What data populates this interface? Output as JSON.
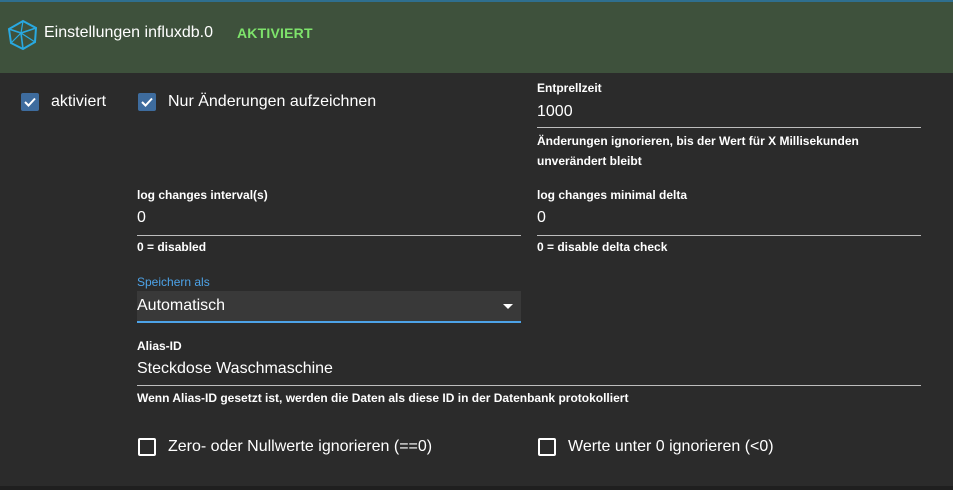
{
  "header": {
    "title": "Einstellungen influxdb.0",
    "status": "AKTIVIERT",
    "icon": "influxdb-logo-icon",
    "background_color": "#3e513c",
    "status_color": "#7ee36b"
  },
  "checkboxes": {
    "enabled": {
      "label": "aktiviert",
      "checked": true
    },
    "changes_only": {
      "label": "Nur Änderungen aufzeichnen",
      "checked": true
    },
    "ignore_zero": {
      "label": "Zero- oder Nullwerte ignorieren (==0)",
      "checked": false
    },
    "ignore_below_zero": {
      "label": "Werte unter 0 ignorieren (<0)",
      "checked": false
    }
  },
  "fields": {
    "debounce": {
      "label": "Entprellzeit",
      "value": "1000",
      "helper_line1": "Änderungen ignorieren, bis der Wert für X Millisekunden",
      "helper_line2": "unverändert bleibt"
    },
    "log_changes_interval": {
      "label": "log changes interval(s)",
      "value": "0",
      "helper": "0 = disabled"
    },
    "log_changes_min_delta": {
      "label": "log changes minimal delta",
      "value": "0",
      "helper": "0 = disable delta check"
    },
    "store_as": {
      "label": "Speichern als",
      "value": "Automatisch"
    },
    "alias_id": {
      "label": "Alias-ID",
      "value": "Steckdose Waschmaschine",
      "helper": "Wenn Alias-ID gesetzt ist, werden die Daten als diese ID in der Datenbank protokolliert"
    }
  },
  "colors": {
    "accent": "#4da3e8",
    "checkbox_checked": "#3e6c9e",
    "background": "#2b2b2b"
  }
}
